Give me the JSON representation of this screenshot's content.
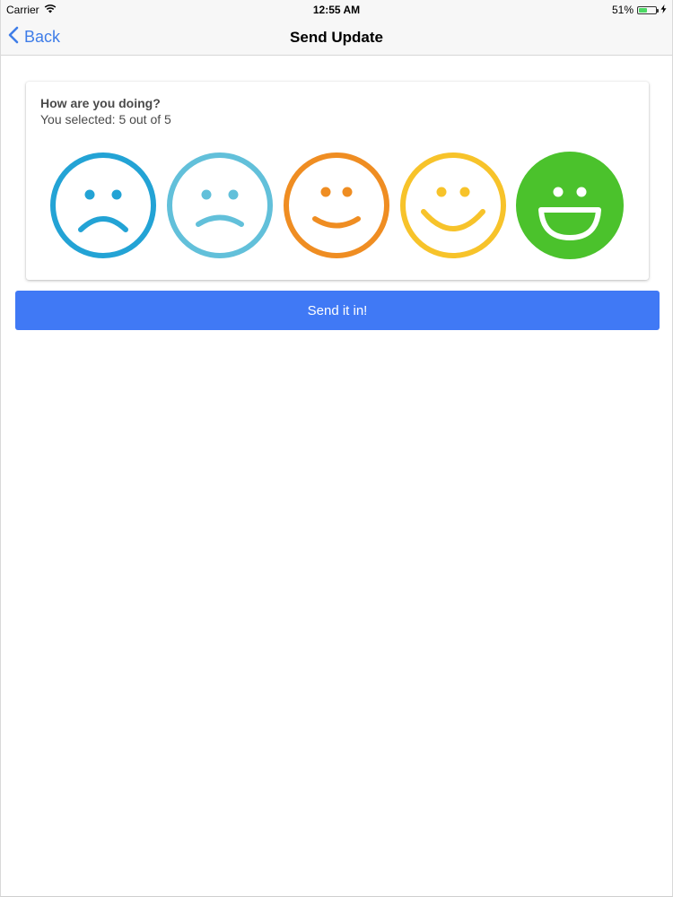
{
  "status_bar": {
    "carrier": "Carrier",
    "time": "12:55 AM",
    "battery_percent": "51%",
    "battery_level": 0.51,
    "wifi_icon": "wifi-icon",
    "charging_icon": "bolt-icon"
  },
  "nav": {
    "back_label": "Back",
    "title": "Send Update"
  },
  "card": {
    "title": "How are you doing?",
    "subtitle": "You selected: 5 out of 5",
    "selected_rating": 5,
    "faces": [
      {
        "icon": "very-sad-face-icon",
        "color": "#23a3d5",
        "selected": false
      },
      {
        "icon": "sad-face-icon",
        "color": "#62c0da",
        "selected": false
      },
      {
        "icon": "smile-face-icon",
        "color": "#ef8d22",
        "selected": false
      },
      {
        "icon": "happy-face-icon",
        "color": "#f7c32a",
        "selected": false
      },
      {
        "icon": "very-happy-face-icon",
        "color": "#4bc22c",
        "selected": true
      }
    ]
  },
  "send_button": {
    "label": "Send it in!",
    "color": "#4079f5"
  },
  "colors": {
    "accent": "#3f7de8"
  }
}
